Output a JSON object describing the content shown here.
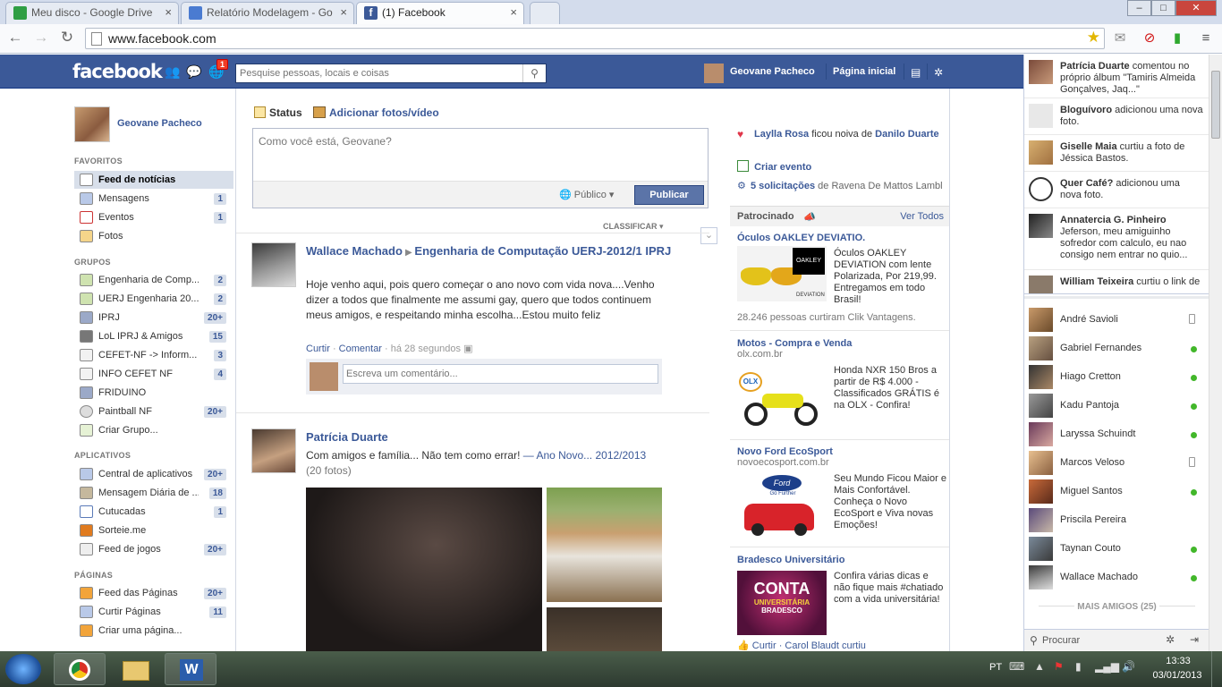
{
  "browser": {
    "tabs": [
      {
        "label": "Meu disco - Google Drive",
        "color": "#2f9e44"
      },
      {
        "label": "Relatório Modelagem - Go",
        "color": "#4a7bd1"
      },
      {
        "label": "(1) Facebook",
        "color": "#3b5998"
      }
    ],
    "url": "www.facebook.com"
  },
  "fb": {
    "logo": "facebook",
    "notif_count": "1",
    "search_placeholder": "Pesquise pessoas, locais e coisas",
    "user_name": "Geovane Pacheco",
    "home": "Página inicial",
    "brand_color": "#3b5998"
  },
  "left": {
    "profile_name": "Geovane Pacheco",
    "sections": [
      {
        "title": "FAVORITOS",
        "items": [
          {
            "label": "Feed de notícias",
            "count": "",
            "selected": true
          },
          {
            "label": "Mensagens",
            "count": "1"
          },
          {
            "label": "Eventos",
            "count": "1"
          },
          {
            "label": "Fotos",
            "count": ""
          }
        ]
      },
      {
        "title": "GRUPOS",
        "items": [
          {
            "label": "Engenharia de Comp...",
            "count": "2"
          },
          {
            "label": "UERJ Engenharia 20...",
            "count": "2"
          },
          {
            "label": "IPRJ",
            "count": "20+"
          },
          {
            "label": "LoL IPRJ & Amigos",
            "count": "15"
          },
          {
            "label": "CEFET-NF -> Inform...",
            "count": "3"
          },
          {
            "label": "INFO CEFET NF",
            "count": "4"
          },
          {
            "label": "FRIDUINO",
            "count": ""
          },
          {
            "label": "Paintball NF",
            "count": "20+"
          },
          {
            "label": "Criar Grupo...",
            "count": ""
          }
        ]
      },
      {
        "title": "APLICATIVOS",
        "items": [
          {
            "label": "Central de aplicativos",
            "count": "20+"
          },
          {
            "label": "Mensagem Diária de ...",
            "count": "18"
          },
          {
            "label": "Cutucadas",
            "count": "1"
          },
          {
            "label": "Sorteie.me",
            "count": ""
          },
          {
            "label": "Feed de jogos",
            "count": "20+"
          }
        ]
      },
      {
        "title": "PÁGINAS",
        "items": [
          {
            "label": "Feed das Páginas",
            "count": "20+"
          },
          {
            "label": "Curtir Páginas",
            "count": "11"
          },
          {
            "label": "Criar uma página...",
            "count": ""
          }
        ]
      }
    ]
  },
  "composer": {
    "tab_status": "Status",
    "tab_photo": "Adicionar fotos/vídeo",
    "placeholder": "Como você está, Geovane?",
    "audience": "Público",
    "publish": "Publicar",
    "sort": "CLASSIFICAR"
  },
  "stories": [
    {
      "author": "Wallace Machado",
      "target": "Engenharia de Computação UERJ-2012/1 IPRJ",
      "text": "Hoje venho aqui, pois quero começar o ano novo com vida nova....Venho dizer a todos que finalmente me assumi gay, quero que todos continuem meus amigos, e respeitando minha escolha...Estou muito feliz",
      "like": "Curtir",
      "comment": "Comentar",
      "time": "há 28 segundos",
      "comment_placeholder": "Escreva um comentário..."
    },
    {
      "author": "Patrícia Duarte",
      "text": "Com amigos e família... Não tem como errar!",
      "album": "— Ano Novo... 2012/2013",
      "photos": "(20 fotos)"
    }
  ],
  "right": {
    "events": [
      {
        "name": "Laylla Rosa",
        "text": " ficou noiva de ",
        "name2": "Danilo Duarte"
      },
      {
        "name": "Criar evento"
      },
      {
        "name": "5 solicitações",
        "text": " de Ravena De Mattos Lambl"
      }
    ],
    "sponsored": "Patrocinado",
    "see_all": "Ver Todos",
    "ads": [
      {
        "title": "Óculos OAKLEY DEVIATIO.",
        "domain": "",
        "text": "Óculos OAKLEY DEVIATION com lente Polarizada, Por 219,99. Entregamos em todo Brasil!",
        "social": "28.246 pessoas curtiram Clik Vantagens."
      },
      {
        "title": "Motos - Compra e Venda",
        "domain": "olx.com.br",
        "text": "Honda NXR 150 Bros a partir de R$ 4.000 - Classificados GRÁTIS é na OLX - Confira!",
        "social": ""
      },
      {
        "title": "Novo Ford EcoSport",
        "domain": "novoecosport.com.br",
        "text": "Seu Mundo Ficou Maior e Mais Confortável. Conheça o Novo EcoSport e Viva novas Emoções!",
        "social": ""
      },
      {
        "title": "Bradesco Universitário",
        "domain": "",
        "text": "Confira várias dicas e não fique mais #chatiado com a vida universitária!",
        "social": "Curtir · Carol Blaudt curtiu"
      }
    ],
    "ad_logo_text": {
      "olx": "OLX",
      "ford": "Ford",
      "ford_sub": "Go Further",
      "conta": "CONTA",
      "conta_sub": "UNIVERSITÁRIA",
      "conta_brand": "BRADESCO",
      "oakley": "OAKLEY",
      "deviation": "DEVIATION"
    }
  },
  "ticker": [
    {
      "name": "Patrícia Duarte",
      "text": " comentou no próprio álbum \"Tamiris Almeida Gonçalves, Jaq...\""
    },
    {
      "name": "Bloguívoro",
      "text": " adicionou uma nova foto."
    },
    {
      "name": "Giselle Maia",
      "text": " curtiu a foto de Jéssica Bastos."
    },
    {
      "name": "Quer Café?",
      "text": " adicionou uma nova foto."
    },
    {
      "name": "Annatercia G. Pinheiro",
      "text": " Jeferson, meu amiguinho sofredor com calculo, eu nao consigo nem entrar no quio..."
    },
    {
      "name": "William Teixeira",
      "text": " curtiu o link de"
    }
  ],
  "chat": {
    "friends": [
      {
        "name": "André Savioli",
        "status": "mobile"
      },
      {
        "name": "Gabriel Fernandes",
        "status": "online"
      },
      {
        "name": "Hiago Cretton",
        "status": "online"
      },
      {
        "name": "Kadu Pantoja",
        "status": "online"
      },
      {
        "name": "Laryssa Schuindt",
        "status": "online"
      },
      {
        "name": "Marcos Veloso",
        "status": "mobile"
      },
      {
        "name": "Miguel Santos",
        "status": "online"
      },
      {
        "name": "Priscila Pereira",
        "status": ""
      },
      {
        "name": "Taynan Couto",
        "status": "online"
      },
      {
        "name": "Wallace Machado",
        "status": "online"
      }
    ],
    "more": "MAIS AMIGOS (25)",
    "search": "Procurar"
  },
  "taskbar": {
    "lang": "PT",
    "time": "13:33",
    "date": "03/01/2013"
  }
}
